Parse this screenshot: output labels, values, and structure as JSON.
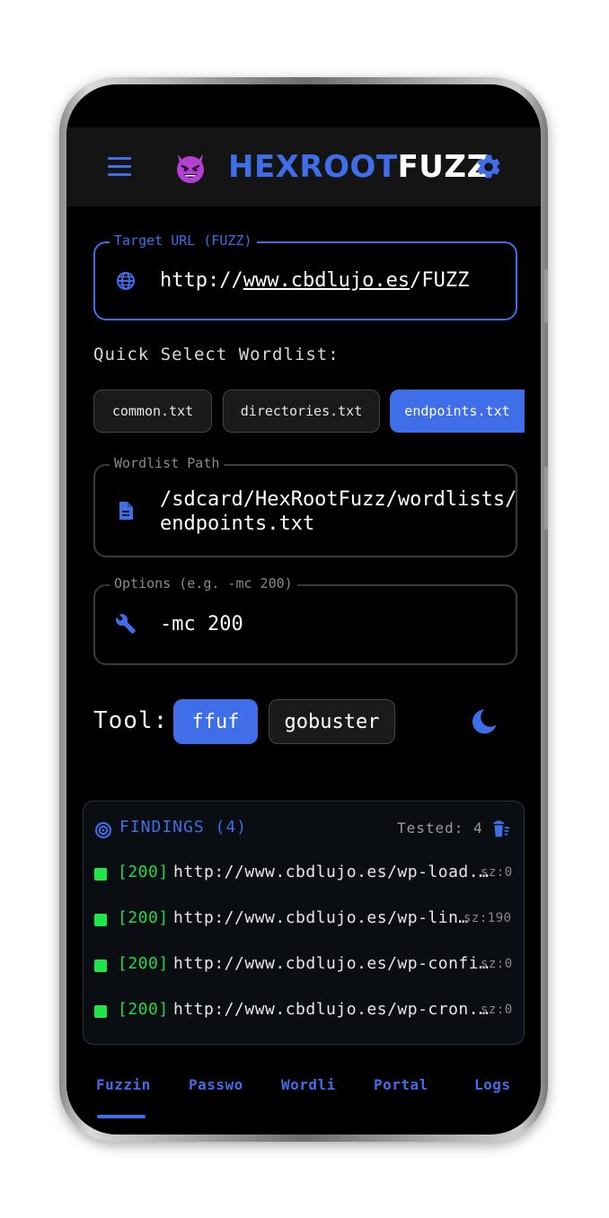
{
  "appbar": {
    "brand_part1": "HEXROOT",
    "brand_part2": "FUZZ"
  },
  "target": {
    "label": "Target URL (FUZZ)",
    "value_prefix": "http://",
    "value_domain": "www.cbdlujo.es",
    "value_suffix": "/FUZZ",
    "icon": "globe-icon"
  },
  "quick_select": {
    "label": "Quick Select Wordlist:",
    "chips": [
      "common.txt",
      "directories.txt",
      "endpoints.txt"
    ],
    "selected": "endpoints.txt"
  },
  "wordlist": {
    "label": "Wordlist Path",
    "line1": "/sdcard/HexRootFuzz/wordlists/",
    "line2": "endpoints.txt",
    "icon": "document-icon"
  },
  "options": {
    "label": "Options (e.g. -mc 200)",
    "value": "-mc 200",
    "icon": "wrench-icon"
  },
  "tool": {
    "label": "Tool:",
    "options": [
      "ffuf",
      "gobuster"
    ],
    "selected": "ffuf"
  },
  "findings": {
    "title": "FINDINGS (4)",
    "tested": "Tested: 4",
    "rows": [
      {
        "status": "[200]",
        "url": "http://www.cbdlujo.es/wp-load.…",
        "size": "sz:0"
      },
      {
        "status": "[200]",
        "url": "http://www.cbdlujo.es/wp-lin…",
        "size": "sz:190"
      },
      {
        "status": "[200]",
        "url": "http://www.cbdlujo.es/wp-confi…",
        "size": "sz:0"
      },
      {
        "status": "[200]",
        "url": "http://www.cbdlujo.es/wp-cron.…",
        "size": "sz:0"
      }
    ]
  },
  "nav": {
    "items": [
      "Fuzzin",
      "Passwo",
      "Wordli",
      "Portal",
      "Logs"
    ],
    "active": "Fuzzin"
  },
  "colors": {
    "accent": "#3f6ee8",
    "success": "#1fe54b",
    "background": "#000000"
  }
}
